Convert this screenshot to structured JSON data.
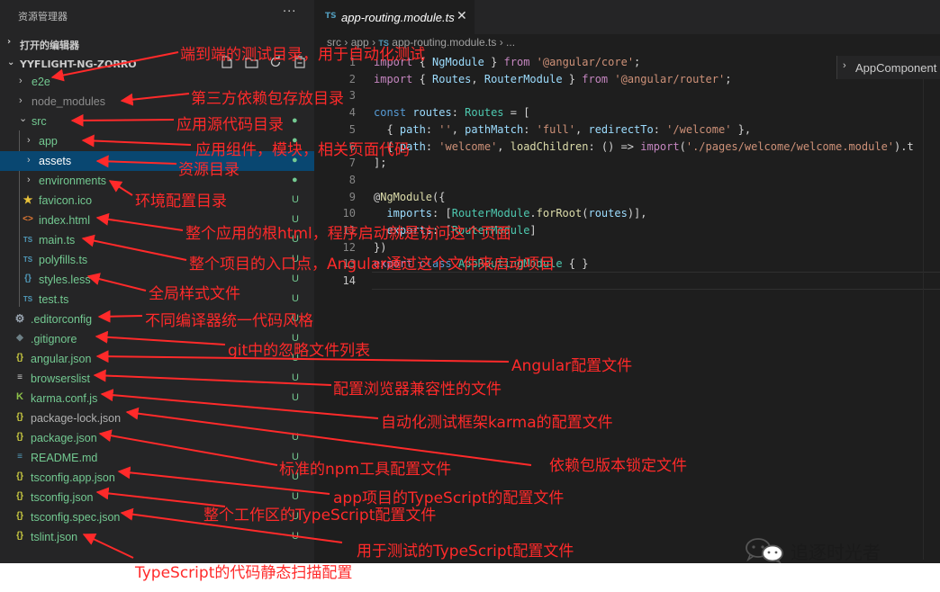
{
  "sidebar": {
    "title": "资源管理器",
    "more": "···",
    "open_editors": "打开的编辑器",
    "project": "YYFLIGHT-NG-ZORRO",
    "toolbar": [
      "new-file-icon",
      "new-folder-icon",
      "refresh-icon",
      "collapse-all-icon"
    ],
    "items": [
      {
        "name": "e2e",
        "chevron": "›",
        "badge": ""
      },
      {
        "name": "node_modules",
        "chevron": "›",
        "badge": ""
      },
      {
        "name": "src",
        "chevron": "⌄",
        "badge": "●"
      },
      {
        "name": "app",
        "chevron": "›",
        "badge": "●"
      },
      {
        "name": "assets",
        "chevron": "›",
        "badge": "●"
      },
      {
        "name": "environments",
        "chevron": "›",
        "badge": "●"
      },
      {
        "name": "favicon.ico",
        "icon": "★",
        "badge": "U"
      },
      {
        "name": "index.html",
        "icon": "<>",
        "badge": "U"
      },
      {
        "name": "main.ts",
        "icon": "TS",
        "badge": "U"
      },
      {
        "name": "polyfills.ts",
        "icon": "TS",
        "badge": "U"
      },
      {
        "name": "styles.less",
        "icon": "{}",
        "badge": "U"
      },
      {
        "name": "test.ts",
        "icon": "TS",
        "badge": "U"
      },
      {
        "name": ".editorconfig",
        "icon": "⚙",
        "badge": "U"
      },
      {
        "name": ".gitignore",
        "icon": "◆",
        "badge": "U"
      },
      {
        "name": "angular.json",
        "icon": "{}",
        "badge": "U"
      },
      {
        "name": "browserslist",
        "icon": "≡",
        "badge": "U"
      },
      {
        "name": "karma.conf.js",
        "icon": "K",
        "badge": "U"
      },
      {
        "name": "package-lock.json",
        "icon": "{}",
        "badge": ""
      },
      {
        "name": "package.json",
        "icon": "{}",
        "badge": "U"
      },
      {
        "name": "README.md",
        "icon": "≡",
        "badge": "U"
      },
      {
        "name": "tsconfig.app.json",
        "icon": "{}",
        "badge": "U"
      },
      {
        "name": "tsconfig.json",
        "icon": "{}",
        "badge": "U"
      },
      {
        "name": "tsconfig.spec.json",
        "icon": "{}",
        "badge": "U"
      },
      {
        "name": "tslint.json",
        "icon": "{}",
        "badge": "U"
      }
    ]
  },
  "editor": {
    "tab": {
      "lang": "TS",
      "name": "app-routing.module.ts",
      "close": "✕"
    },
    "breadcrumb": {
      "a": "src",
      "b": "app",
      "lang": "TS",
      "file": "app-routing.module.ts",
      "tail": "..."
    },
    "sticky": {
      "chevron": "›",
      "label": "AppComponent"
    },
    "line_numbers": [
      "1",
      "2",
      "3",
      "4",
      "5",
      "6",
      "7",
      "8",
      "9",
      "10",
      "11",
      "12",
      "13",
      "14"
    ],
    "lines": [
      [
        [
          "kw2",
          "import"
        ],
        [
          "p",
          " { "
        ],
        [
          "id",
          "NgModule"
        ],
        [
          "p",
          " } "
        ],
        [
          "kw2",
          "from"
        ],
        [
          "p",
          " "
        ],
        [
          "str",
          "'@angular/core'"
        ],
        [
          "p",
          ";"
        ]
      ],
      [
        [
          "kw2",
          "import"
        ],
        [
          "p",
          " { "
        ],
        [
          "id",
          "Routes"
        ],
        [
          "p",
          ", "
        ],
        [
          "id",
          "RouterModule"
        ],
        [
          "p",
          " } "
        ],
        [
          "kw2",
          "from"
        ],
        [
          "p",
          " "
        ],
        [
          "str",
          "'@angular/router'"
        ],
        [
          "p",
          ";"
        ]
      ],
      [],
      [
        [
          "kw",
          "const"
        ],
        [
          "p",
          " "
        ],
        [
          "id",
          "routes"
        ],
        [
          "p",
          ": "
        ],
        [
          "ty",
          "Routes"
        ],
        [
          "p",
          " = ["
        ]
      ],
      [
        [
          "p",
          "  { "
        ],
        [
          "id",
          "path"
        ],
        [
          "p",
          ": "
        ],
        [
          "str",
          "''"
        ],
        [
          "p",
          ", "
        ],
        [
          "id",
          "pathMatch"
        ],
        [
          "p",
          ": "
        ],
        [
          "str",
          "'full'"
        ],
        [
          "p",
          ", "
        ],
        [
          "id",
          "redirectTo"
        ],
        [
          "p",
          ": "
        ],
        [
          "str",
          "'/welcome'"
        ],
        [
          "p",
          " },"
        ]
      ],
      [
        [
          "p",
          "  { "
        ],
        [
          "id",
          "path"
        ],
        [
          "p",
          ": "
        ],
        [
          "str",
          "'welcome'"
        ],
        [
          "p",
          ", "
        ],
        [
          "fn",
          "loadChildren"
        ],
        [
          "p",
          ": () => "
        ],
        [
          "kw2",
          "import"
        ],
        [
          "p",
          "("
        ],
        [
          "str",
          "'./pages/welcome/welcome.module'"
        ],
        [
          "p",
          ").t"
        ]
      ],
      [
        [
          "p",
          "];"
        ]
      ],
      [],
      [
        [
          "p",
          "@"
        ],
        [
          "fn",
          "NgModule"
        ],
        [
          "p",
          "({"
        ]
      ],
      [
        [
          "p",
          "  "
        ],
        [
          "id",
          "imports"
        ],
        [
          "p",
          ": ["
        ],
        [
          "ty",
          "RouterModule"
        ],
        [
          "p",
          "."
        ],
        [
          "fn",
          "forRoot"
        ],
        [
          "p",
          "("
        ],
        [
          "id",
          "routes"
        ],
        [
          "p",
          ")],"
        ]
      ],
      [
        [
          "p",
          "  "
        ],
        [
          "id",
          "exports"
        ],
        [
          "p",
          ": ["
        ],
        [
          "ty",
          "RouterModule"
        ],
        [
          "p",
          "]"
        ]
      ],
      [
        [
          "p",
          "})"
        ]
      ],
      [
        [
          "kw2",
          "export"
        ],
        [
          "p",
          " "
        ],
        [
          "kw",
          "class"
        ],
        [
          "p",
          " "
        ],
        [
          "ty",
          "AppRoutingModule"
        ],
        [
          "p",
          " { }"
        ]
      ],
      []
    ]
  },
  "annotations": [
    "端到端的测试目录，用于自动化测试",
    "第三方依赖包存放目录",
    "应用源代码目录",
    "应用组件，模块，相关页面代码",
    "资源目录",
    "环境配置目录",
    "整个应用的根html，程序启动就是访问这个页面",
    "整个项目的入口点，Angular通过这个文件来启动项目",
    "全局样式文件",
    "不同编译器统一代码风格",
    "git中的忽略文件列表",
    "Angular配置文件",
    "配置浏览器兼容性的文件",
    "自动化测试框架karma的配置文件",
    "标准的npm工具配置文件",
    "依赖包版本锁定文件",
    "app项目的TypeScript的配置文件",
    "整个工作区的TypeScript配置文件",
    "用于测试的TypeScript配置文件",
    "TypeScript的代码静态扫描配置"
  ],
  "watermark": {
    "text": "追逐时光者"
  },
  "colors": {
    "sidebar_bg": "#252526",
    "editor_bg": "#1e1e1e",
    "selection": "#094771",
    "untracked": "#73c991",
    "modified": "#e2c08d",
    "annotation_red": "#ff2a2a"
  }
}
